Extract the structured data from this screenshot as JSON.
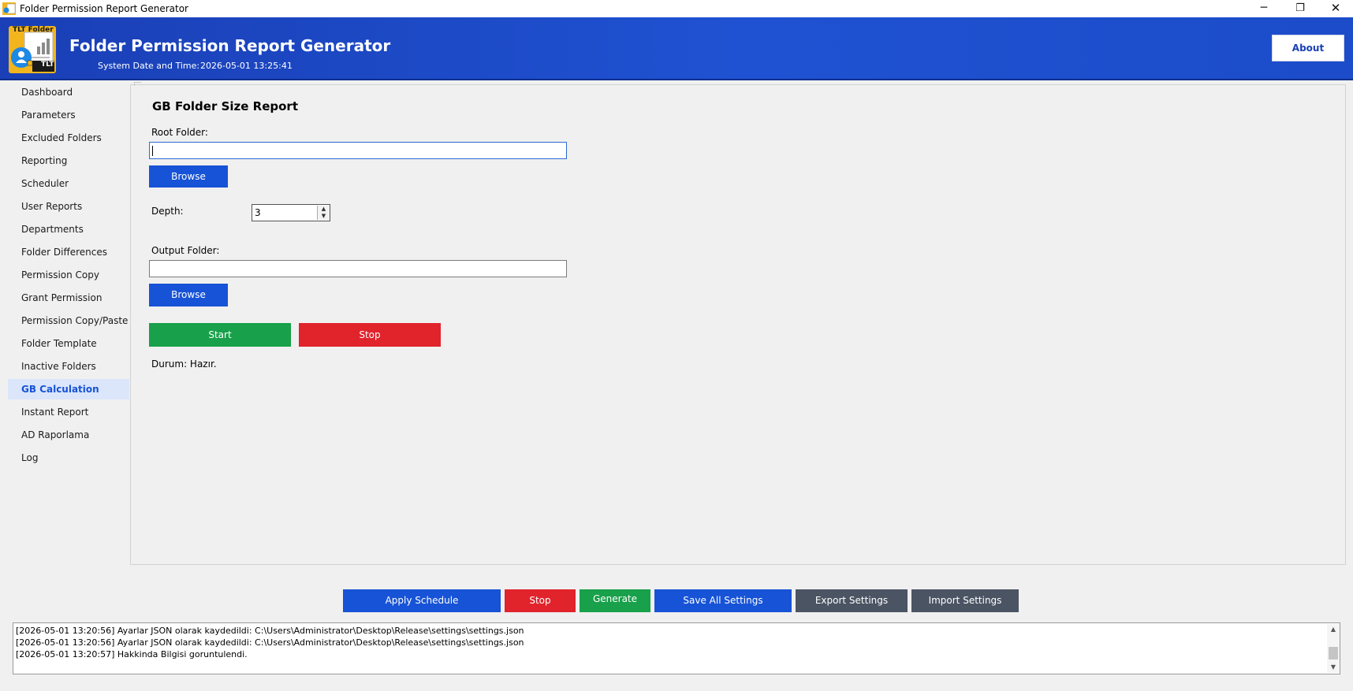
{
  "window": {
    "title": "Folder Permission Report Generator",
    "controls": {
      "minimize": "─",
      "maximize": "❐",
      "close": "✕"
    }
  },
  "header": {
    "logo_text_top": "TLT Folder",
    "logo_text_badge": "TLT",
    "title": "Folder Permission Report Generator",
    "datetime_label": "System Date and Time:",
    "datetime_value": "2026-05-01 13:25:41",
    "about_label": "About"
  },
  "sidebar": {
    "items": [
      {
        "label": "Dashboard"
      },
      {
        "label": "Parameters"
      },
      {
        "label": "Excluded Folders"
      },
      {
        "label": "Reporting"
      },
      {
        "label": "Scheduler"
      },
      {
        "label": "User Reports"
      },
      {
        "label": "Departments"
      },
      {
        "label": "Folder Differences"
      },
      {
        "label": "Permission Copy"
      },
      {
        "label": "Grant Permission"
      },
      {
        "label": "Permission Copy/Paste"
      },
      {
        "label": "Folder Template"
      },
      {
        "label": "Inactive Folders"
      },
      {
        "label": "GB Calculation",
        "active": true
      },
      {
        "label": "Instant Report"
      },
      {
        "label": "AD Raporlama"
      },
      {
        "label": "Log"
      }
    ]
  },
  "main": {
    "section_title": "GB Folder Size Report",
    "root_folder_label": "Root Folder:",
    "root_folder_value": "",
    "browse_label": "Browse",
    "depth_label": "Depth:",
    "depth_value": "3",
    "output_folder_label": "Output Folder:",
    "output_folder_value": "",
    "start_label": "Start",
    "stop_label": "Stop",
    "status_text": "Durum: Hazır."
  },
  "toolbar": {
    "apply_schedule": "Apply Schedule",
    "stop": "Stop",
    "generate": "Generate",
    "save_all": "Save All Settings",
    "export": "Export Settings",
    "import": "Import Settings"
  },
  "log": {
    "lines": [
      "[2026-05-01 13:20:56] Ayarlar JSON olarak kaydedildi: C:\\Users\\Administrator\\Desktop\\Release\\settings\\settings.json",
      "[2026-05-01 13:20:56] Ayarlar JSON olarak kaydedildi: C:\\Users\\Administrator\\Desktop\\Release\\settings\\settings.json",
      "[2026-05-01 13:20:57] Hakkinda Bilgisi goruntulendi."
    ]
  },
  "colors": {
    "header_blue": "#1f52d2",
    "primary_blue": "#1753d6",
    "start_green": "#18a04a",
    "stop_red": "#e1232b",
    "settings_gray": "#4b5463",
    "active_nav_bg": "#dbe6fb"
  }
}
